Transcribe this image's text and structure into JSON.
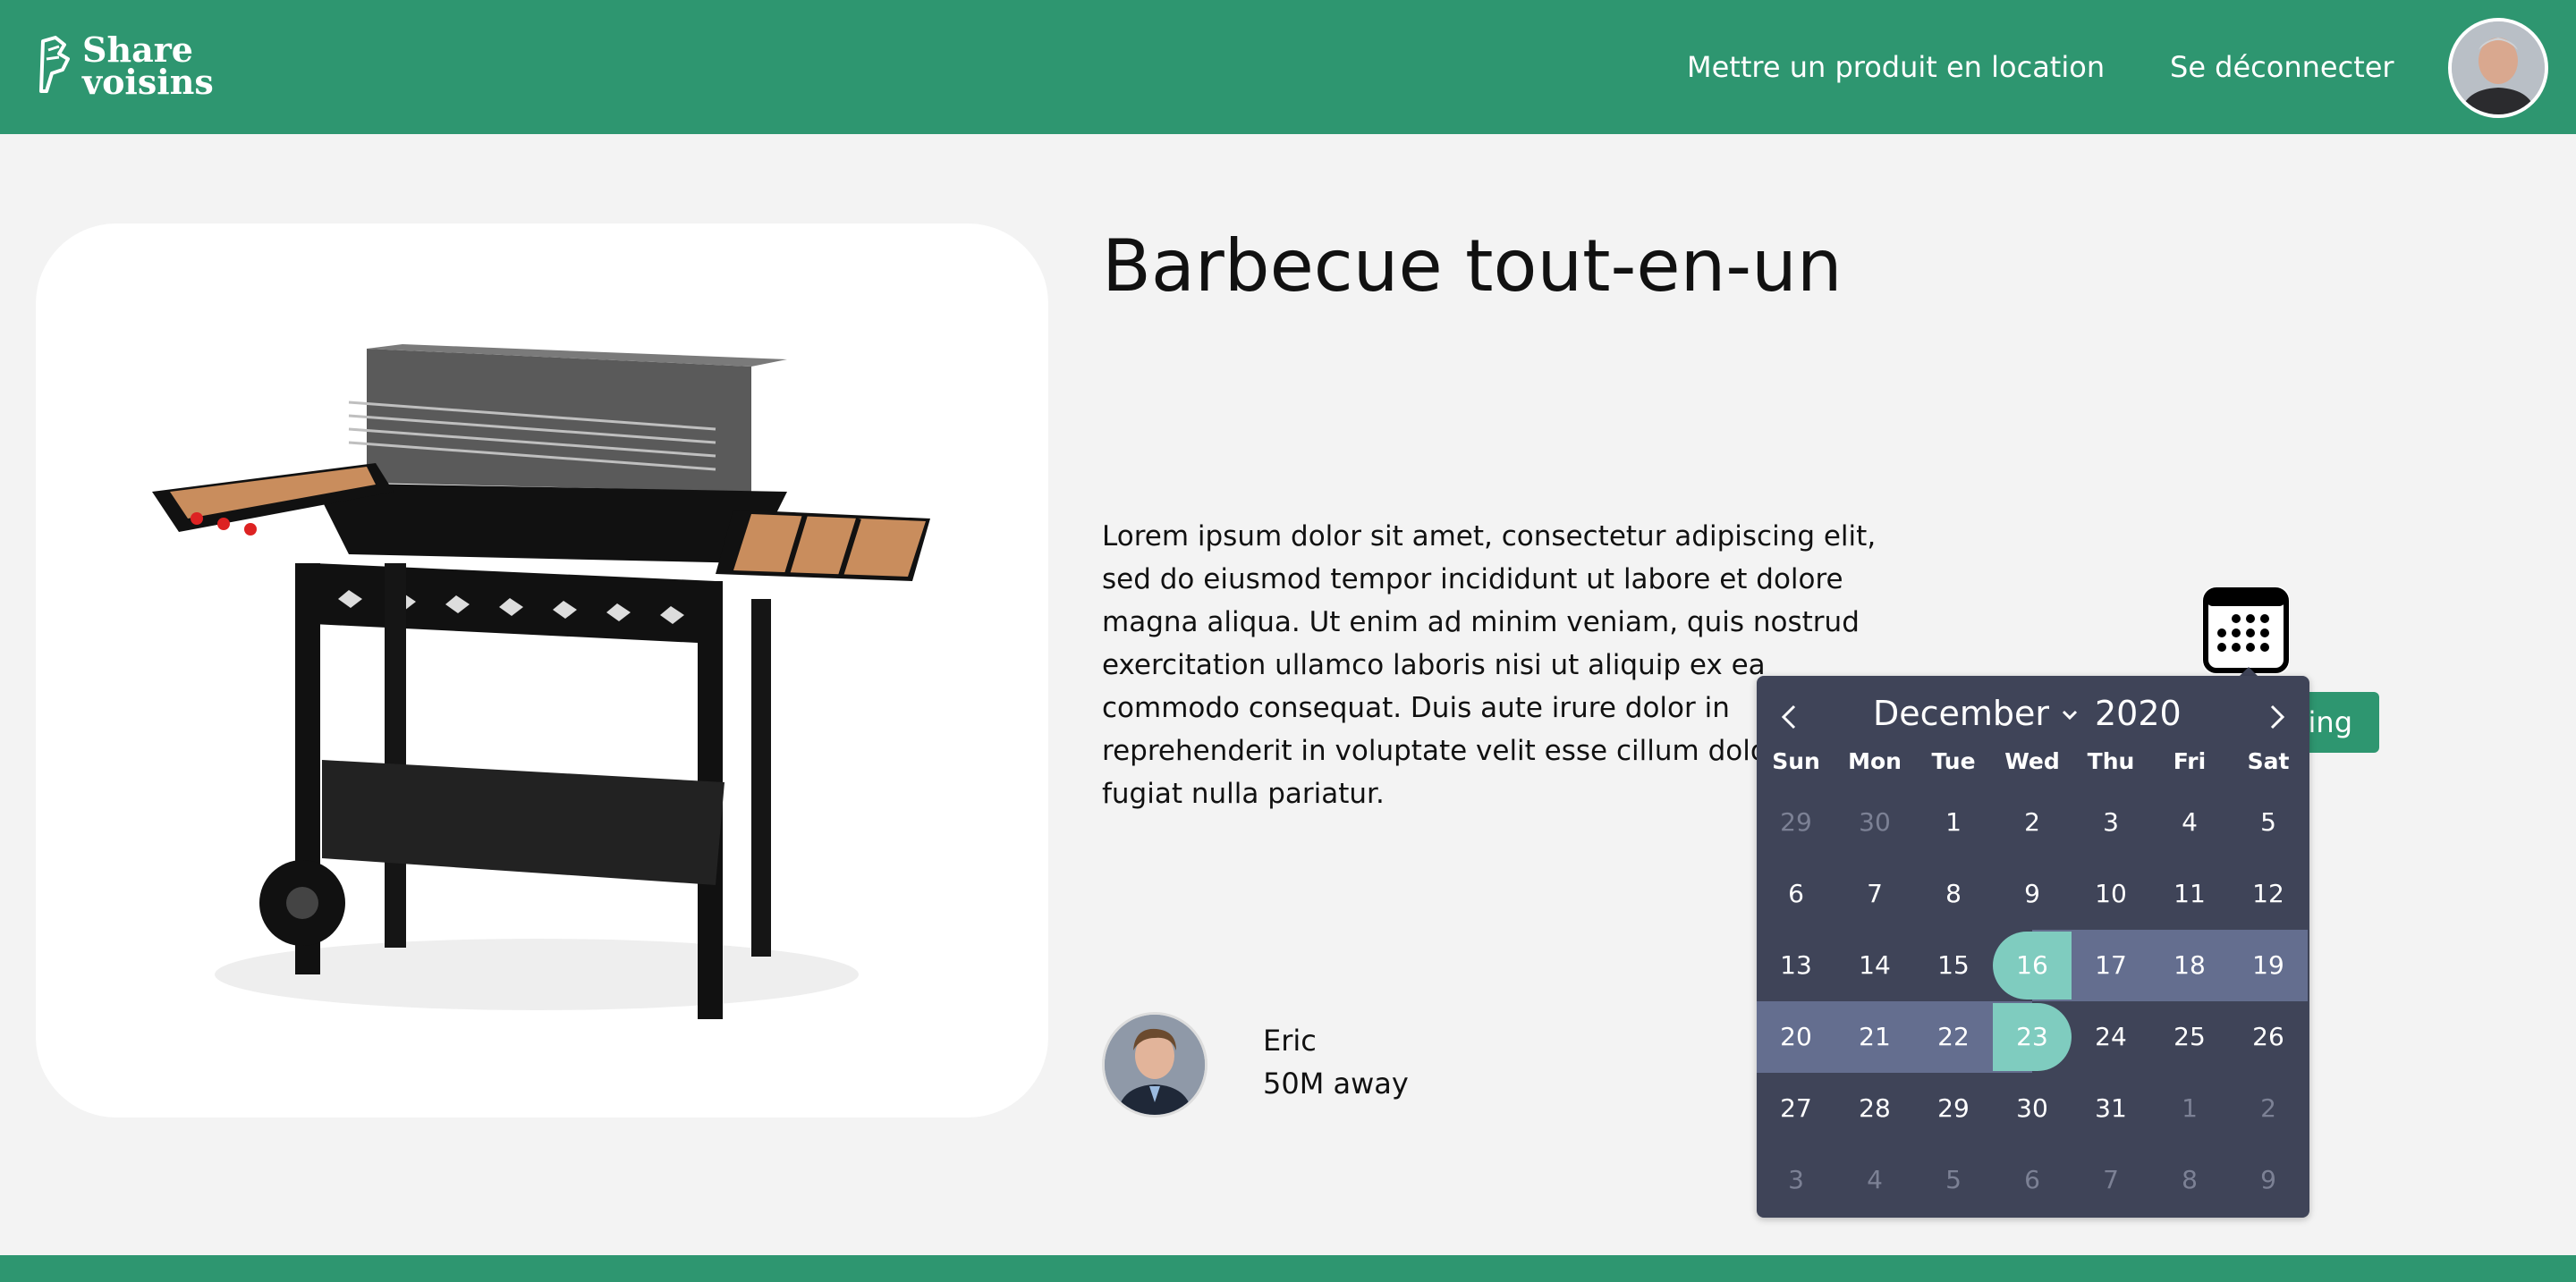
{
  "header": {
    "logo_line1": "Share",
    "logo_line2": "voisins",
    "nav_rent_label": "Mettre un produit en location",
    "nav_logout_label": "Se déconnecter",
    "accent_color": "#2e9670"
  },
  "product": {
    "title": "Barbecue tout-en-un",
    "description": "Lorem ipsum dolor sit amet, consectetur adipiscing elit, sed do eiusmod tempor incididunt ut labore et dolore magna aliqua. Ut enim ad minim veniam, quis nostrud exercitation ullamco laboris nisi ut aliquip ex ea commodo consequat. Duis aute irure dolor in reprehenderit in voluptate velit esse cillum dolore eu fugiat nulla pariatur.",
    "image_icon": "barbecue-grill-image"
  },
  "owner": {
    "name": "Eric",
    "distance": "50M away"
  },
  "booking": {
    "button_label": "Booking"
  },
  "datepicker": {
    "month": "December",
    "year": "2020",
    "weekdays": [
      "Sun",
      "Mon",
      "Tue",
      "Wed",
      "Thu",
      "Fri",
      "Sat"
    ],
    "days": [
      {
        "d": "29",
        "muted": true
      },
      {
        "d": "30",
        "muted": true
      },
      {
        "d": "1"
      },
      {
        "d": "2"
      },
      {
        "d": "3"
      },
      {
        "d": "4"
      },
      {
        "d": "5"
      },
      {
        "d": "6"
      },
      {
        "d": "7"
      },
      {
        "d": "8"
      },
      {
        "d": "9"
      },
      {
        "d": "10"
      },
      {
        "d": "11"
      },
      {
        "d": "12"
      },
      {
        "d": "13"
      },
      {
        "d": "14"
      },
      {
        "d": "15"
      },
      {
        "d": "16",
        "state": "start"
      },
      {
        "d": "17",
        "state": "range"
      },
      {
        "d": "18",
        "state": "range"
      },
      {
        "d": "19",
        "state": "range"
      },
      {
        "d": "20",
        "state": "range"
      },
      {
        "d": "21",
        "state": "range"
      },
      {
        "d": "22",
        "state": "range"
      },
      {
        "d": "23",
        "state": "end"
      },
      {
        "d": "24"
      },
      {
        "d": "25"
      },
      {
        "d": "26"
      },
      {
        "d": "27"
      },
      {
        "d": "28"
      },
      {
        "d": "29"
      },
      {
        "d": "30"
      },
      {
        "d": "31"
      },
      {
        "d": "1",
        "muted": true
      },
      {
        "d": "2",
        "muted": true
      },
      {
        "d": "3",
        "muted": true
      },
      {
        "d": "4",
        "muted": true
      },
      {
        "d": "5",
        "muted": true
      },
      {
        "d": "6",
        "muted": true
      },
      {
        "d": "7",
        "muted": true
      },
      {
        "d": "8",
        "muted": true
      },
      {
        "d": "9",
        "muted": true
      }
    ],
    "colors": {
      "background": "#3f4458",
      "range": "#646e8f",
      "selected": "#7fccbf"
    }
  }
}
